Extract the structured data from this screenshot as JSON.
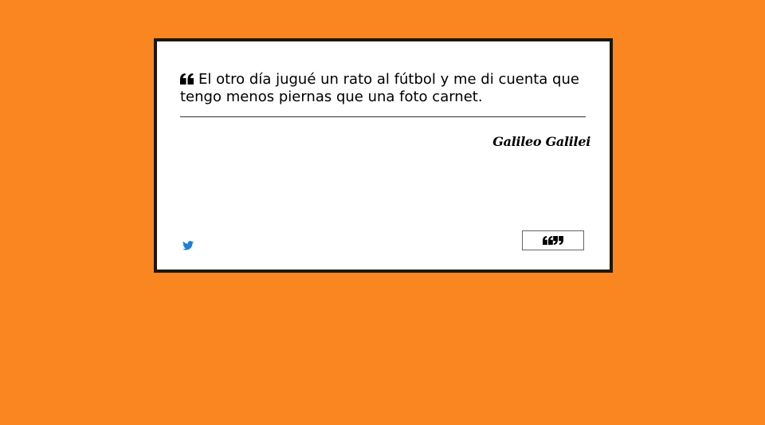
{
  "quote": {
    "text": "El otro día jugué un rato al fútbol y me di cuenta que tengo menos piernas que una foto carnet.",
    "author": "Galileo Galilei"
  },
  "icons": {
    "quote_open": "quote-left-icon",
    "tweet": "twitter-icon",
    "new_quote": "quote-marks-icon"
  },
  "colors": {
    "background": "#fa8621",
    "card": "#ffffff",
    "card_border": "#1c1712",
    "twitter": "#1d7fd6"
  }
}
